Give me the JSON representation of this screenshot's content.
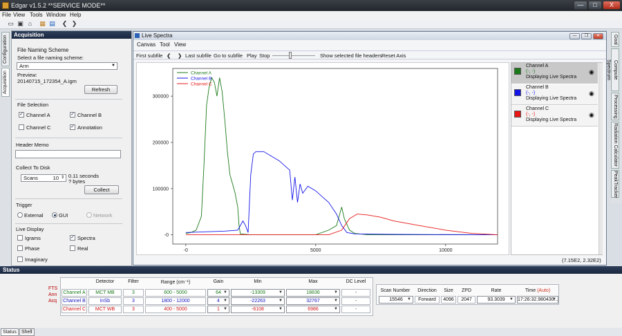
{
  "app": {
    "title": "Edgar v1.5.2 **SERVICE MODE**",
    "min": "—",
    "max": "□",
    "close": "X"
  },
  "menu": [
    "File",
    "View",
    "Tools",
    "Window",
    "Help"
  ],
  "left_tabs": [
    "Configuration",
    "Acquisition"
  ],
  "acq": {
    "title": "Acquisition",
    "naming_title": "File Naming Scheme",
    "select_label": "Select a file naming scheme:",
    "scheme": "Arm",
    "preview_label": "Preview:",
    "preview_value": "20140715_172354_A.igm",
    "refresh": "Refresh",
    "file_selection": "File Selection",
    "checks": [
      {
        "label": "Channel A",
        "checked": "✓"
      },
      {
        "label": "Channel B",
        "checked": "✓"
      },
      {
        "label": "Channel C",
        "checked": ""
      },
      {
        "label": "Annotation",
        "checked": "✓"
      }
    ],
    "header_memo": "Header Memo",
    "collect_title": "Collect To Disk",
    "scans_label": "Scans",
    "scans_value": "10",
    "seconds": "0.11 seconds",
    "bytes": "? bytes",
    "collect": "Collect",
    "trigger": "Trigger",
    "trig": [
      "External",
      "GUI",
      "Network"
    ],
    "live_display": "Live Display",
    "live": [
      {
        "label": "Igrams",
        "checked": ""
      },
      {
        "label": "Spectra",
        "checked": "✓"
      },
      {
        "label": "Phase",
        "checked": ""
      },
      {
        "label": "Real",
        "checked": ""
      },
      {
        "label": "Imaginary",
        "checked": ""
      }
    ]
  },
  "live": {
    "title": "Live Spectra",
    "menu": [
      "Canvas",
      "Tool",
      "View"
    ],
    "tools": {
      "first": "First subfile",
      "last": "Last subfile",
      "goto": "Go to subfile",
      "play": "Play",
      "stop": "Stop",
      "headers": "Show selected file headers",
      "reset": "Reset Axis"
    },
    "coord": "(7.15E2, 2.32E2)",
    "channels": [
      {
        "name": "Channel A",
        "val": "(-, -)",
        "status": "Displaying Live Spectra",
        "color": "#1a7a1a"
      },
      {
        "name": "Channel B",
        "val": "(-, -)",
        "status": "Displaying Live Spectra",
        "color": "#1515e8"
      },
      {
        "name": "Channel C",
        "val": "(-, -)",
        "status": "Displaying Live Spectra",
        "color": "#e81515"
      }
    ]
  },
  "chart_data": {
    "type": "line",
    "xlim": [
      -500,
      12000
    ],
    "ylim": [
      -20000,
      360000
    ],
    "xticks": [
      "-0",
      "5000",
      "10000"
    ],
    "yticks": [
      "-0",
      "100000",
      "200000",
      "300000"
    ],
    "series": [
      {
        "name": "Channel A",
        "color": "#1a7a1a",
        "points": [
          [
            0,
            3000
          ],
          [
            200,
            5000
          ],
          [
            400,
            10000
          ],
          [
            600,
            40000
          ],
          [
            700,
            150000
          ],
          [
            800,
            280000
          ],
          [
            900,
            320000
          ],
          [
            1000,
            340000
          ],
          [
            1100,
            330000
          ],
          [
            1200,
            300000
          ],
          [
            1300,
            340000
          ],
          [
            1400,
            310000
          ],
          [
            1500,
            250000
          ],
          [
            1600,
            180000
          ],
          [
            1700,
            130000
          ],
          [
            1800,
            110000
          ],
          [
            1900,
            90000
          ],
          [
            2000,
            60000
          ],
          [
            2050,
            20000
          ],
          [
            2100,
            2000
          ],
          [
            2500,
            0
          ],
          [
            3000,
            0
          ],
          [
            4000,
            0
          ],
          [
            5000,
            0
          ],
          [
            5500,
            10000
          ],
          [
            5800,
            20000
          ],
          [
            6000,
            60000
          ],
          [
            6100,
            35000
          ],
          [
            6300,
            10000
          ],
          [
            6500,
            3000
          ],
          [
            7000,
            0
          ],
          [
            12000,
            0
          ]
        ]
      },
      {
        "name": "Channel B",
        "color": "#1515e8",
        "points": [
          [
            0,
            5000
          ],
          [
            1500,
            8000
          ],
          [
            2000,
            10000
          ],
          [
            2200,
            30000
          ],
          [
            2300,
            20000
          ],
          [
            2400,
            5000
          ],
          [
            2500,
            130000
          ],
          [
            2600,
            175000
          ],
          [
            2700,
            180000
          ],
          [
            3000,
            180000
          ],
          [
            3300,
            170000
          ],
          [
            3600,
            160000
          ],
          [
            3800,
            150000
          ],
          [
            4000,
            140000
          ],
          [
            4100,
            75000
          ],
          [
            4200,
            125000
          ],
          [
            4300,
            70000
          ],
          [
            4400,
            110000
          ],
          [
            4500,
            90000
          ],
          [
            4700,
            105000
          ],
          [
            5000,
            95000
          ],
          [
            5300,
            80000
          ],
          [
            5500,
            70000
          ],
          [
            5800,
            45000
          ],
          [
            6000,
            20000
          ],
          [
            6200,
            5000
          ],
          [
            6500,
            2000
          ],
          [
            8000,
            1000
          ],
          [
            12000,
            0
          ]
        ]
      },
      {
        "name": "Channel C",
        "color": "#e81515",
        "points": [
          [
            0,
            0
          ],
          [
            3000,
            0
          ],
          [
            5500,
            0
          ],
          [
            6000,
            10000
          ],
          [
            6300,
            35000
          ],
          [
            6600,
            45000
          ],
          [
            7000,
            43000
          ],
          [
            7500,
            38000
          ],
          [
            8000,
            30000
          ],
          [
            9000,
            20000
          ],
          [
            10000,
            10000
          ],
          [
            11000,
            3000
          ],
          [
            12000,
            0
          ]
        ]
      }
    ]
  },
  "right_tabs": [
    "Goal",
    "Compute Spectrum",
    "Processing",
    "Radiation Calculator",
    "PeakTracker"
  ],
  "status": {
    "title": "Status",
    "fts": [
      "FTS",
      "Ann",
      "Acq"
    ],
    "headers": [
      "Detector",
      "Filter",
      "Range (cm⁻¹)",
      "Gain",
      "Min",
      "Max",
      "DC Level"
    ],
    "rows": [
      {
        "name": "Channel A",
        "detector": "MCT MB",
        "filter": "3",
        "range": "600 - 5000",
        "gain": "64",
        "min": "-13309",
        "max": "18836",
        "dc": "-",
        "color": "#1a7a1a"
      },
      {
        "name": "Channel B",
        "detector": "InSb",
        "filter": "3",
        "range": "1800 - 12000",
        "gain": "4",
        "min": "-22263",
        "max": "32767",
        "dc": "-",
        "color": "#1515c0"
      },
      {
        "name": "Channel C",
        "detector": "MCT WB",
        "filter": "3",
        "range": "400 - 5000",
        "gain": "1",
        "min": "-6108",
        "max": "6986",
        "dc": "-",
        "color": "#d01515"
      }
    ],
    "scan_headers": [
      "Scan Number",
      "Direction",
      "Size",
      "ZPD",
      "Rate",
      "Time"
    ],
    "auto": "(Auto)",
    "scan": {
      "number": "15546",
      "direction": "Forward",
      "size": "4096",
      "zpd": "2047",
      "rate": "93.3039",
      "time": "17:26:32.980430..."
    }
  },
  "bottom_tabs": [
    "Status",
    "Shell"
  ]
}
